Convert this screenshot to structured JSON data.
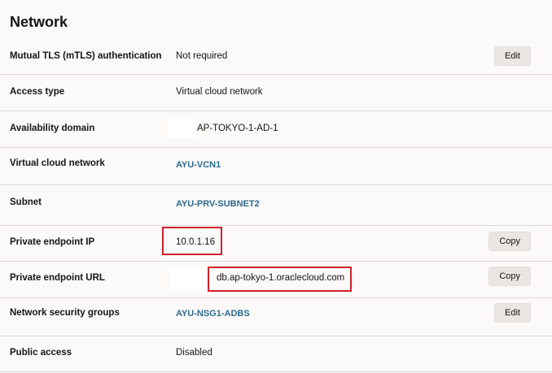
{
  "section": {
    "title": "Network"
  },
  "rows": {
    "mtls": {
      "label": "Mutual TLS (mTLS) authentication",
      "value": "Not required",
      "action": "Edit"
    },
    "access_type": {
      "label": "Access type",
      "value": "Virtual cloud network"
    },
    "availability_domain": {
      "label": "Availability domain",
      "value": "AP-TOKYO-1-AD-1"
    },
    "vcn": {
      "label": "Virtual cloud network",
      "value": "AYU-VCN1"
    },
    "subnet": {
      "label": "Subnet",
      "value": "AYU-PRV-SUBNET2"
    },
    "private_ip": {
      "label": "Private endpoint IP",
      "value": "10.0.1.16",
      "action": "Copy"
    },
    "private_url": {
      "label": "Private endpoint URL",
      "value": "db.ap-tokyo-1.oraclecloud.com",
      "action": "Copy"
    },
    "nsg": {
      "label": "Network security groups",
      "value": "AYU-NSG1-ADBS",
      "action": "Edit"
    },
    "public_access": {
      "label": "Public access",
      "value": "Disabled"
    }
  },
  "colors": {
    "link": "#2b6a8c",
    "highlight": "#d21f2c",
    "button_bg": "#e9e6e3"
  }
}
